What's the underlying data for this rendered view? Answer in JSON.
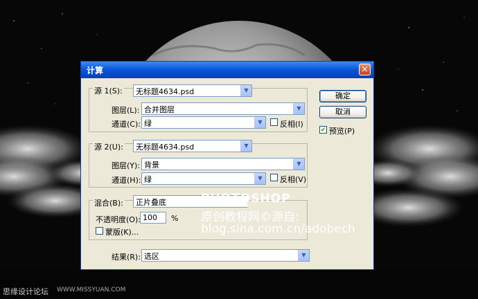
{
  "dialog": {
    "title": "计算",
    "close_icon": "×",
    "source1": {
      "label": "源 1(S):",
      "file": "无标题4634.psd",
      "layer_label": "图层(L):",
      "layer_value": "合并图层",
      "channel_label": "通道(C):",
      "channel_value": "绿",
      "invert_label": "反相(I)",
      "invert_checked": false
    },
    "source2": {
      "label": "源 2(U):",
      "file": "无标题4634.psd",
      "layer_label": "图层(Y):",
      "layer_value": "背景",
      "channel_label": "通道(H):",
      "channel_value": "绿",
      "invert_label": "反相(V)",
      "invert_checked": false
    },
    "blending": {
      "label": "混合(B):",
      "mode": "正片叠底",
      "opacity_label": "不透明度(O):",
      "opacity_value": "100",
      "opacity_unit": "%",
      "mask_label": "蒙版(K)...",
      "mask_checked": false
    },
    "result": {
      "label": "结果(R):",
      "value": "选区"
    },
    "ok_label": "确定",
    "cancel_label": "取消",
    "preview_label": "预览(P)",
    "preview_checked": true
  },
  "watermark": {
    "line1": "PHOTOSHOP",
    "line2": "原创教程网©源自:",
    "line3": "blog.sina.com.cn/adobech",
    "footer_left": "思缘设计论坛",
    "footer_right": "WWW.MISSYUAN.COM"
  }
}
